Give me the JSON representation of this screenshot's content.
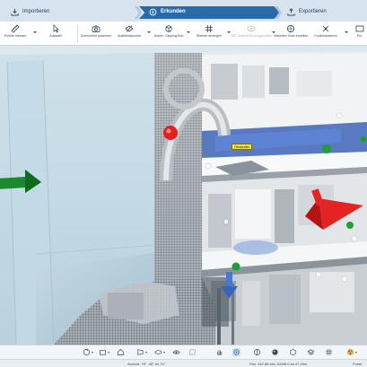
{
  "workflow": {
    "tabs": [
      {
        "label": "Importieren",
        "icon": "import-icon",
        "active": false
      },
      {
        "label": "Erkunden",
        "icon": "explore-icon",
        "active": true
      },
      {
        "label": "Exportieren",
        "icon": "export-icon",
        "active": false
      }
    ]
  },
  "toolbar": {
    "items": [
      {
        "label": "Punkte messen",
        "icon": "ruler-icon",
        "has_dropdown": true,
        "enabled": true
      },
      {
        "label": "Auswahl",
        "icon": "select-cursor-icon",
        "has_dropdown": false,
        "enabled": true
      },
      {
        "label": "Screenshot speichern",
        "icon": "camera-icon",
        "has_dropdown": false,
        "enabled": true
      },
      {
        "label": "Ausblendpunkte",
        "icon": "hide-points-icon",
        "has_dropdown": true,
        "enabled": true
      },
      {
        "label": "Autom. Clipping-Box",
        "icon": "clipping-box-icon",
        "has_dropdown": true,
        "enabled": true
      },
      {
        "label": "Ebenen anzeigen",
        "icon": "grid-icon",
        "has_dropdown": true,
        "enabled": true
      },
      {
        "label": "360°-Ansicht für ausgewählte",
        "icon": "panorama-icon",
        "has_dropdown": true,
        "enabled": false
      },
      {
        "label": "Virtuellen Scan erstellen",
        "icon": "virtual-scan-icon",
        "has_dropdown": false,
        "enabled": true
      },
      {
        "label": "Punktmarkieren",
        "icon": "point-marker-icon",
        "has_dropdown": true,
        "enabled": true
      },
      {
        "label": "Pro",
        "icon": "more-icon",
        "has_dropdown": false,
        "enabled": true
      }
    ]
  },
  "viewport": {
    "tag_label": "Obstkäfer"
  },
  "bottom_toolbar": {
    "tools": [
      "orbit-icon",
      "camera-view-icon",
      "home-view-icon",
      "perspective-icon",
      "walk-icon",
      "eye-icon",
      "clip-icon",
      "hand-icon",
      "focus-icon",
      "scale-icon",
      "sphere-icon",
      "cube-icon",
      "layers-icon",
      "grid-icon",
      "color-palette-icon",
      "settings-icon"
    ]
  },
  "status": {
    "view": "Ansicht: 79° -28° bs 74°",
    "position": "Pos: 342.88 ebs 10096.0 bs 47.49m",
    "mode": "Punkt"
  },
  "colors": {
    "accent": "#2a6aa8",
    "tabbar": "#d7e4ef",
    "marker_green": "#1e9e35",
    "marker_red": "#e32020",
    "marker_blue": "#4a78d0",
    "tag_yellow": "#f8e94a"
  }
}
